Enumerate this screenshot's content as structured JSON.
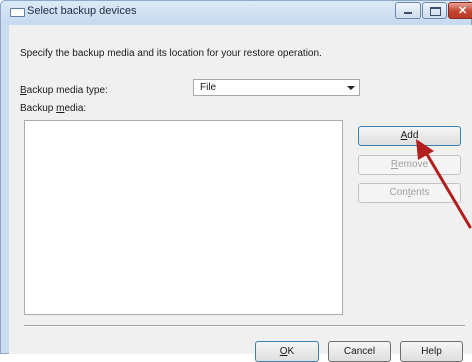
{
  "window": {
    "title": "Select backup devices",
    "min_icon": "minimize-icon",
    "max_icon": "maximize-icon",
    "close_icon": "close-icon"
  },
  "description": "Specify the backup media and its location for your restore operation.",
  "media_type": {
    "label_underlined": "B",
    "label_rest": "ackup media type:",
    "selected": "File"
  },
  "media_list": {
    "label_start": "Backup ",
    "label_underlined": "m",
    "label_rest": "edia:"
  },
  "buttons": {
    "add": {
      "underlined": "A",
      "rest": "dd"
    },
    "remove": {
      "underlined": "R",
      "rest": "emove"
    },
    "contents": {
      "start": "Con",
      "underlined": "t",
      "rest": "ents"
    },
    "ok": {
      "underlined": "O",
      "rest": "K"
    },
    "cancel": "Cancel",
    "help": "Help"
  },
  "annotation": {
    "color": "#b21f1f"
  }
}
